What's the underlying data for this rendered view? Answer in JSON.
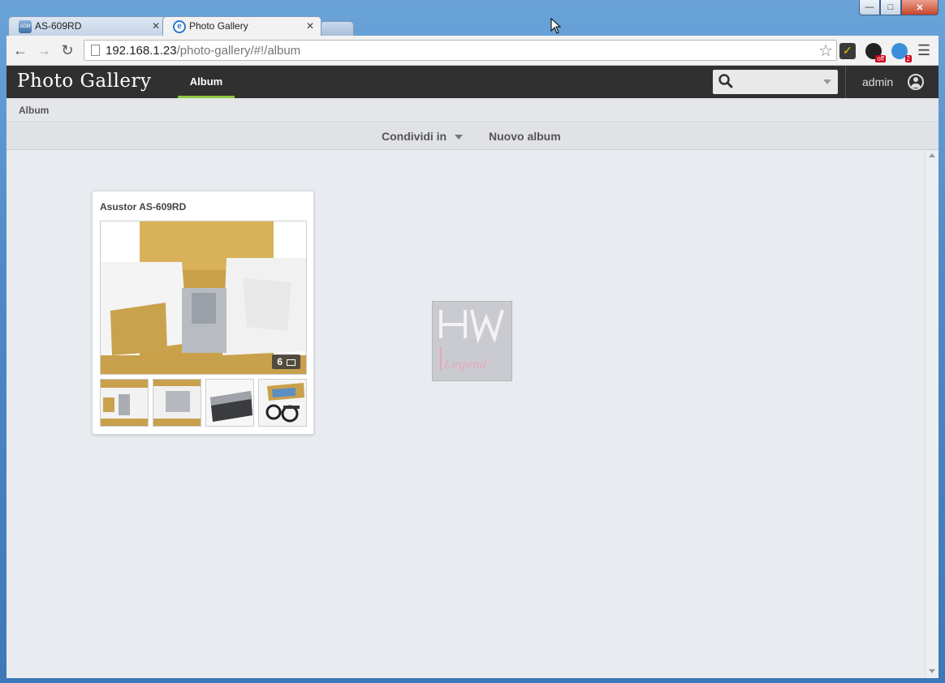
{
  "browser": {
    "tabs": [
      {
        "title": "AS-609RD",
        "favicon": "adm-favicon-icon"
      },
      {
        "title": "Photo Gallery",
        "favicon": "photo-gallery-favicon-icon",
        "active": true
      }
    ],
    "url_host": "192.168.1.23",
    "url_path": "/photo-gallery/#!/album",
    "ext2_badge": "off",
    "ext3_badge": "2"
  },
  "app": {
    "brand": "Photo Gallery",
    "nav_active": "Album",
    "user": "admin",
    "accent_color": "#8cc63f"
  },
  "breadcrumb": "Album",
  "actions": {
    "share": "Condividi in",
    "new_album": "Nuovo album"
  },
  "album": {
    "title": "Asustor AS-609RD",
    "photo_count": "6",
    "thumbnails": 4
  },
  "watermark": {
    "text": "Legend"
  }
}
